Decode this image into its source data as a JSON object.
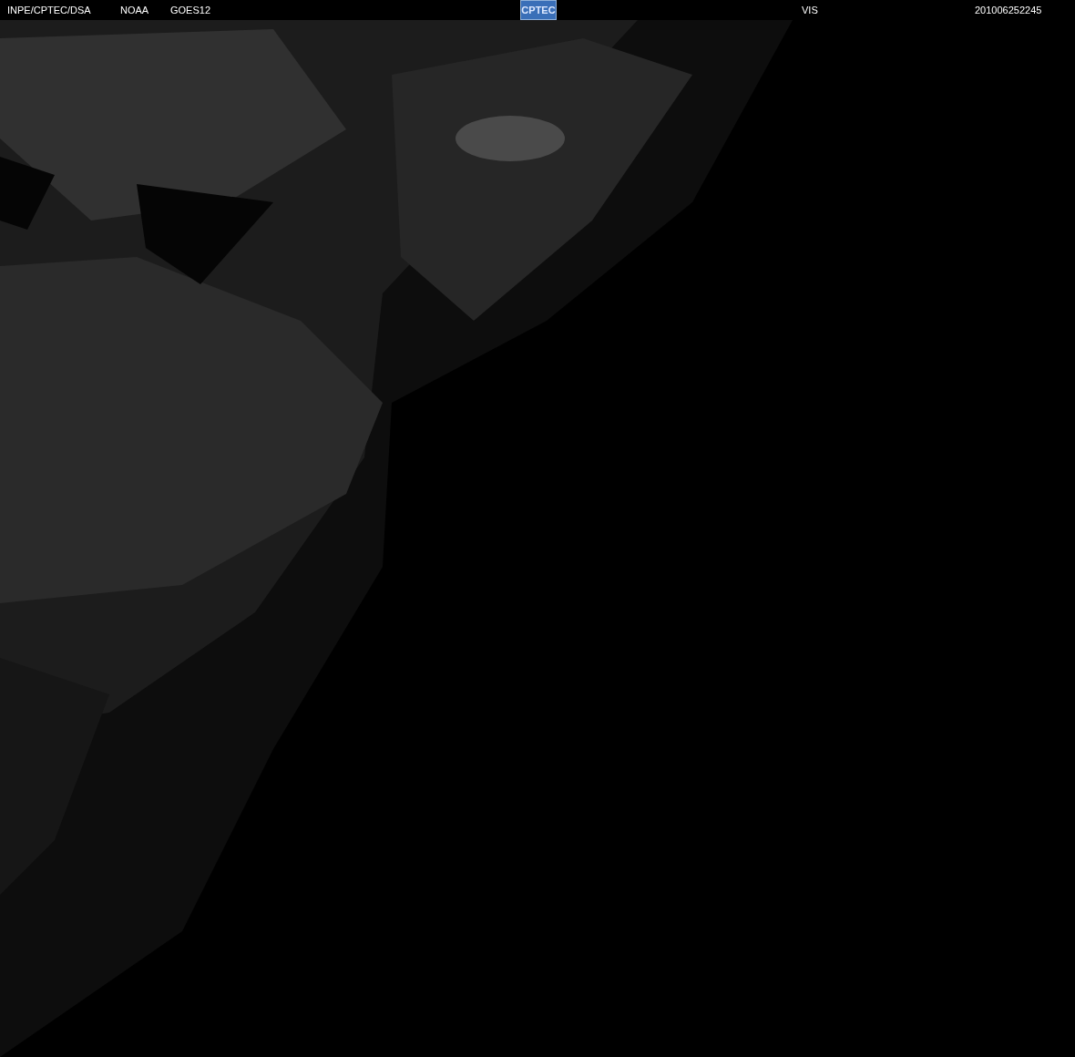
{
  "header": {
    "left_labels": [
      "INPE/CPTEC/DSA",
      "NOAA",
      "GOES12"
    ],
    "logo_text": "CPTEC",
    "channel": "VIS",
    "timestamp": "201006252245"
  }
}
